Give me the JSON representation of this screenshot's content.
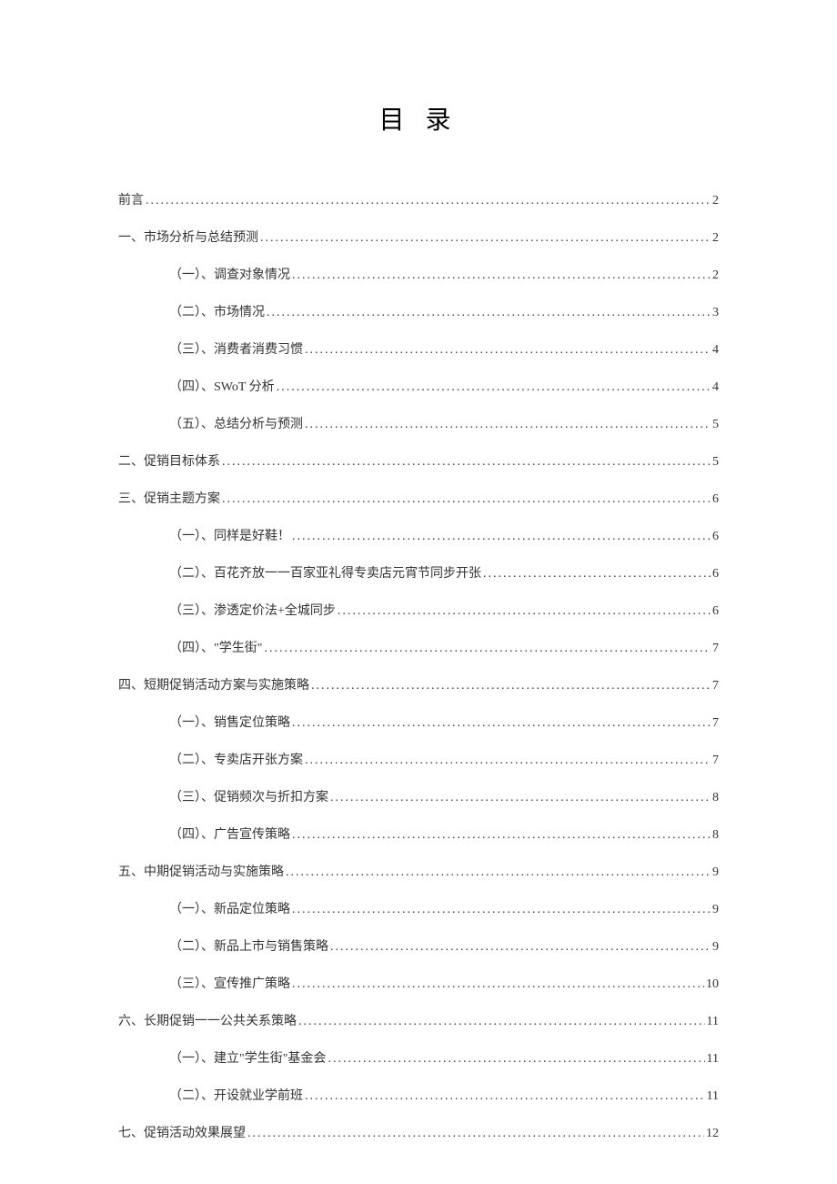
{
  "title": "目 录",
  "toc": [
    {
      "level": 1,
      "label": "前言",
      "page": "2"
    },
    {
      "level": 1,
      "label": "一、市场分析与总结预测",
      "page": "2"
    },
    {
      "level": 2,
      "label": "（一）、调查对象情况",
      "page": "2"
    },
    {
      "level": 2,
      "label": "（二）、市场情况",
      "page": "3"
    },
    {
      "level": 2,
      "label": "（三）、消费者消费习惯",
      "page": "4"
    },
    {
      "level": 2,
      "label": "（四）、SWoT 分析",
      "page": "4"
    },
    {
      "level": 2,
      "label": "（五）、总结分析与预测",
      "page": "5"
    },
    {
      "level": 1,
      "label": "二、促销目标体系",
      "page": "5"
    },
    {
      "level": 1,
      "label": "三、促销主题方案",
      "page": "6"
    },
    {
      "level": 2,
      "label": "（一）、同样是好鞋！",
      "page": "6"
    },
    {
      "level": 2,
      "label": "（二）、百花齐放一一百家亚礼得专卖店元宵节同步开张",
      "page": "6"
    },
    {
      "level": 2,
      "label": "（三）、渗透定价法+全城同步",
      "page": "6"
    },
    {
      "level": 2,
      "label": "（四）、\"学生街\"",
      "page": "7"
    },
    {
      "level": 1,
      "label": "四、短期促销活动方案与实施策略",
      "page": "7"
    },
    {
      "level": 2,
      "label": "（一）、销售定位策略",
      "page": "7"
    },
    {
      "level": 2,
      "label": "（二）、专卖店开张方案",
      "page": "7"
    },
    {
      "level": 2,
      "label": "（三）、促销频次与折扣方案",
      "page": "8"
    },
    {
      "level": 2,
      "label": "（四）、广告宣传策略",
      "page": "8"
    },
    {
      "level": 1,
      "label": "五、中期促销活动与实施策略",
      "page": "9"
    },
    {
      "level": 2,
      "label": "（一）、新品定位策略",
      "page": "9"
    },
    {
      "level": 2,
      "label": "（二）、新品上市与销售策略",
      "page": "9"
    },
    {
      "level": 2,
      "label": "（三）、宣传推广策略",
      "page": "10"
    },
    {
      "level": 1,
      "label": "六、长期促销一一公共关系策略",
      "page": "11"
    },
    {
      "level": 2,
      "label": "（一）、建立\"学生街\"基金会",
      "page": "11"
    },
    {
      "level": 2,
      "label": "（二）、开设就业学前班",
      "page": "11"
    },
    {
      "level": 1,
      "label": "七、促销活动效果展望",
      "page": "12"
    }
  ]
}
